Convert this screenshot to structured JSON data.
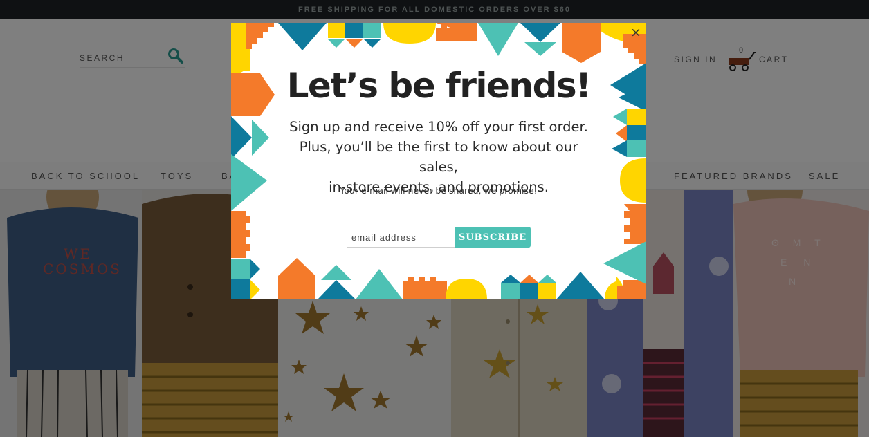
{
  "announcement": {
    "text": "FREE SHIPPING FOR ALL DOMESTIC ORDERS OVER $60"
  },
  "header": {
    "search": {
      "placeholder": "SEARCH",
      "icon": "magnifier-icon"
    },
    "sign_in": "SIGN IN",
    "cart": {
      "count": "0",
      "label": "CART",
      "icon": "wagon-icon"
    }
  },
  "nav": {
    "items": [
      {
        "label": "BACK TO SCHOOL"
      },
      {
        "label": "TOYS"
      },
      {
        "label": "BA"
      },
      {
        "label": "FEATURED BRANDS"
      },
      {
        "label": "SALE"
      }
    ]
  },
  "hero": {
    "sweatshirt_print": [
      "WE",
      "COSMOS"
    ],
    "pink_sweatshirt_print": [
      "ʘ M T",
      "E N",
      "N"
    ]
  },
  "modal": {
    "close": "×",
    "title": "Let’s be friends!",
    "body_lines": [
      "Sign up and receive 10% off your first order.",
      "Plus, you’ll be the first to know about our sales,",
      "in-store events, and promotions."
    ],
    "note": "Your e-mail will never be shared, we promise!",
    "email_placeholder": "email address",
    "subscribe_label": "SUBSCRIBE"
  },
  "colors": {
    "orange": "#f47a2a",
    "teal": "#4dc1b4",
    "blue": "#0e7a9c",
    "yellow": "#ffd500",
    "announce_bg": "#1e2326"
  }
}
